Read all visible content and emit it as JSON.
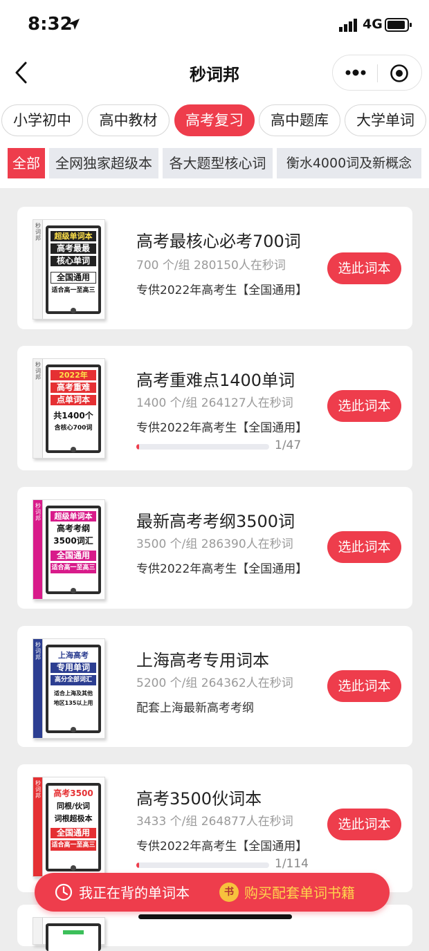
{
  "status": {
    "time": "8:32",
    "network": "4G"
  },
  "nav": {
    "title": "秒词邦"
  },
  "tabs": [
    {
      "label": "小学初中",
      "active": false
    },
    {
      "label": "高中教材",
      "active": false
    },
    {
      "label": "高考复习",
      "active": true
    },
    {
      "label": "高中题库",
      "active": false
    },
    {
      "label": "大学单词",
      "active": false
    }
  ],
  "subtabs": [
    {
      "label": "全部",
      "active": true
    },
    {
      "label": "全网独家超级本",
      "active": false
    },
    {
      "label": "各大题型核心词",
      "active": false
    },
    {
      "label": "衡水4000词及新概念",
      "active": false
    }
  ],
  "pick_label": "选此词本",
  "books": [
    {
      "title": "高考最核心必考700词",
      "meta": "700 个/组   280150人在秒词",
      "desc": "专供2022年高考生【全国通用】",
      "cover": {
        "brand": "秒词邦",
        "lines": [
          "超级单词本",
          "高考最最",
          "核心单词",
          "全国通用",
          "适合高一至高三"
        ]
      }
    },
    {
      "title": "高考重难点1400单词",
      "meta": "1400 个/组   264127人在秒词",
      "desc": "专供2022年高考生【全国通用】",
      "progress": {
        "value": 1,
        "total": 47,
        "text": "1/47"
      },
      "cover": {
        "brand": "秒词邦",
        "lines": [
          "2022年",
          "高考重难",
          "点单词本",
          "共1400个",
          "含核心700词"
        ]
      }
    },
    {
      "title": "最新高考考纲3500词",
      "meta": "3500 个/组   286390人在秒词",
      "desc": "专供2022年高考生【全国通用】",
      "cover": {
        "brand": "秒词邦",
        "lines": [
          "超级单词本",
          "高考考纲",
          "3500词汇",
          "全国通用",
          "适合高一至高三"
        ]
      }
    },
    {
      "title": "上海高考专用词本",
      "meta": "5200 个/组   264362人在秒词",
      "desc": "配套上海最新高考考纲",
      "cover": {
        "brand": "秒词邦",
        "lines": [
          "上海高考",
          "专用单词",
          "高分全部词汇",
          "适合上海及其他",
          "地区135以上用"
        ]
      }
    },
    {
      "title": "高考3500伙词本",
      "meta": "3433 个/组   264877人在秒词",
      "desc": "专供2022年高考生【全国通用】",
      "progress": {
        "value": 1,
        "total": 114,
        "text": "1/114"
      },
      "cover": {
        "brand": "秒词邦",
        "lines": [
          "高考3500",
          "同根/伙词",
          "词根超极本",
          "全国通用",
          "适合高一至高三"
        ]
      }
    }
  ],
  "bottom_bar": {
    "left_label": "我正在背的单词本",
    "book_badge": "书",
    "right_label": "购买配套单词书籍"
  }
}
